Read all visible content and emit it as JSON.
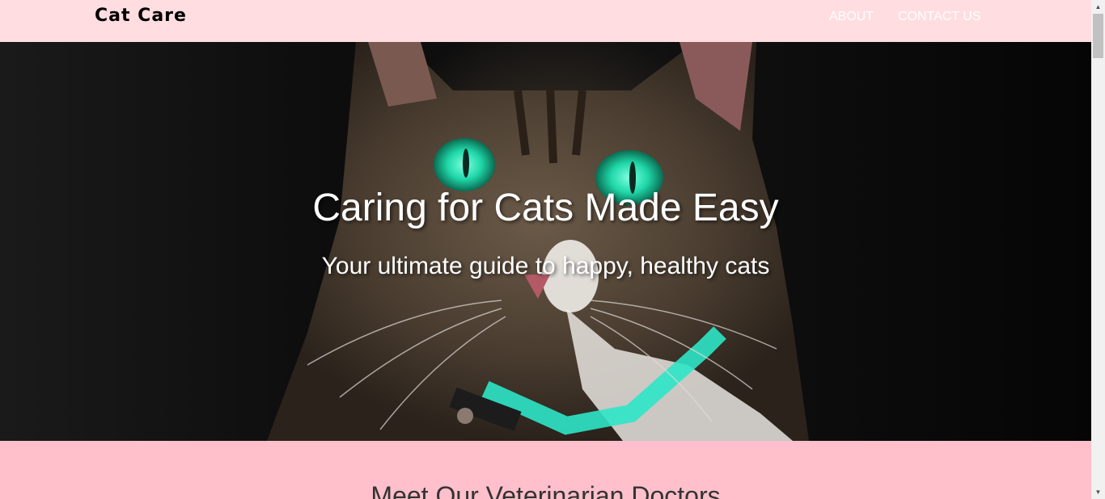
{
  "nav": {
    "brand": "Cat Care",
    "links": [
      "ABOUT",
      "CONTACT US"
    ]
  },
  "hero": {
    "title": "Caring for Cats Made Easy",
    "subtitle": "Your ultimate guide to happy, healthy cats",
    "image": "tabby-cat-photo"
  },
  "section": {
    "title": "Meet Our Veterinarian Doctors"
  },
  "colors": {
    "nav_bg": "#ffdde1",
    "page_bg": "#ffc0cb",
    "eye": "#1fd7a8",
    "collar": "#2ee6c8"
  },
  "scrollbar": {
    "up_icon": "arrow-up-icon",
    "down_icon": "arrow-down-icon"
  }
}
